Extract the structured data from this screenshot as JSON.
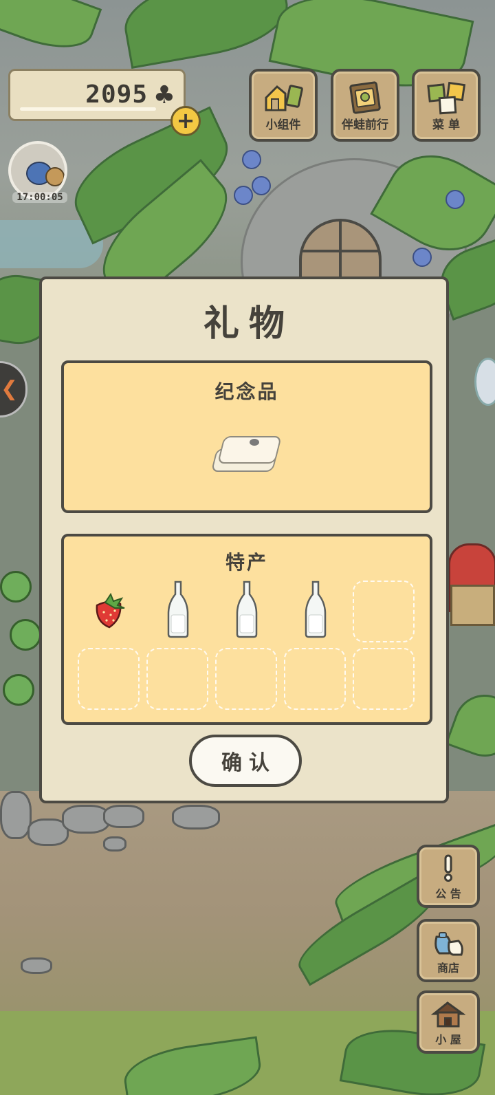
{
  "hud": {
    "clover_count": "2095",
    "clover_symbol": "♣",
    "add_symbol": "+",
    "visitor_timer": "17:00:05"
  },
  "top_menu": [
    {
      "label": "小组件",
      "icon": "widget-icon"
    },
    {
      "label": "伴蛙前行",
      "icon": "journal-icon"
    },
    {
      "label": "菜 单",
      "icon": "menu-icon"
    }
  ],
  "side_menu": [
    {
      "label": "公 告",
      "icon": "notice-icon"
    },
    {
      "label": "商店",
      "icon": "shop-icon"
    },
    {
      "label": "小 屋",
      "icon": "house-icon"
    }
  ],
  "dialog": {
    "title": "礼物",
    "souvenir": {
      "title": "纪念品",
      "item_icon": "towel-icon"
    },
    "specialty": {
      "title": "特产",
      "slots": [
        {
          "item": "strawberry-icon"
        },
        {
          "item": "bottle-icon"
        },
        {
          "item": "bottle-icon"
        },
        {
          "item": "bottle-icon"
        },
        {
          "item": null
        },
        {
          "item": null
        },
        {
          "item": null
        },
        {
          "item": null
        },
        {
          "item": null
        },
        {
          "item": null
        }
      ]
    },
    "confirm_label": "确认"
  },
  "colors": {
    "dialog_bg": "#ebe3c9",
    "panel_bg": "#fde09e",
    "outline": "#4c4a43",
    "wood_button": "#c7ac80",
    "coin_yellow": "#f3c843"
  }
}
